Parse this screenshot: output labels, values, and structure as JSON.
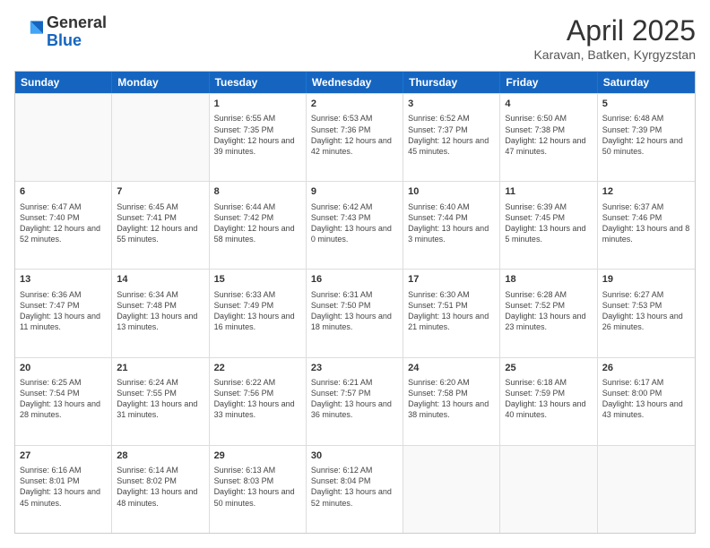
{
  "header": {
    "logo_general": "General",
    "logo_blue": "Blue",
    "title": "April 2025",
    "location": "Karavan, Batken, Kyrgyzstan"
  },
  "weekdays": [
    "Sunday",
    "Monday",
    "Tuesday",
    "Wednesday",
    "Thursday",
    "Friday",
    "Saturday"
  ],
  "rows": [
    [
      {
        "day": "",
        "info": ""
      },
      {
        "day": "",
        "info": ""
      },
      {
        "day": "1",
        "info": "Sunrise: 6:55 AM\nSunset: 7:35 PM\nDaylight: 12 hours and 39 minutes."
      },
      {
        "day": "2",
        "info": "Sunrise: 6:53 AM\nSunset: 7:36 PM\nDaylight: 12 hours and 42 minutes."
      },
      {
        "day": "3",
        "info": "Sunrise: 6:52 AM\nSunset: 7:37 PM\nDaylight: 12 hours and 45 minutes."
      },
      {
        "day": "4",
        "info": "Sunrise: 6:50 AM\nSunset: 7:38 PM\nDaylight: 12 hours and 47 minutes."
      },
      {
        "day": "5",
        "info": "Sunrise: 6:48 AM\nSunset: 7:39 PM\nDaylight: 12 hours and 50 minutes."
      }
    ],
    [
      {
        "day": "6",
        "info": "Sunrise: 6:47 AM\nSunset: 7:40 PM\nDaylight: 12 hours and 52 minutes."
      },
      {
        "day": "7",
        "info": "Sunrise: 6:45 AM\nSunset: 7:41 PM\nDaylight: 12 hours and 55 minutes."
      },
      {
        "day": "8",
        "info": "Sunrise: 6:44 AM\nSunset: 7:42 PM\nDaylight: 12 hours and 58 minutes."
      },
      {
        "day": "9",
        "info": "Sunrise: 6:42 AM\nSunset: 7:43 PM\nDaylight: 13 hours and 0 minutes."
      },
      {
        "day": "10",
        "info": "Sunrise: 6:40 AM\nSunset: 7:44 PM\nDaylight: 13 hours and 3 minutes."
      },
      {
        "day": "11",
        "info": "Sunrise: 6:39 AM\nSunset: 7:45 PM\nDaylight: 13 hours and 5 minutes."
      },
      {
        "day": "12",
        "info": "Sunrise: 6:37 AM\nSunset: 7:46 PM\nDaylight: 13 hours and 8 minutes."
      }
    ],
    [
      {
        "day": "13",
        "info": "Sunrise: 6:36 AM\nSunset: 7:47 PM\nDaylight: 13 hours and 11 minutes."
      },
      {
        "day": "14",
        "info": "Sunrise: 6:34 AM\nSunset: 7:48 PM\nDaylight: 13 hours and 13 minutes."
      },
      {
        "day": "15",
        "info": "Sunrise: 6:33 AM\nSunset: 7:49 PM\nDaylight: 13 hours and 16 minutes."
      },
      {
        "day": "16",
        "info": "Sunrise: 6:31 AM\nSunset: 7:50 PM\nDaylight: 13 hours and 18 minutes."
      },
      {
        "day": "17",
        "info": "Sunrise: 6:30 AM\nSunset: 7:51 PM\nDaylight: 13 hours and 21 minutes."
      },
      {
        "day": "18",
        "info": "Sunrise: 6:28 AM\nSunset: 7:52 PM\nDaylight: 13 hours and 23 minutes."
      },
      {
        "day": "19",
        "info": "Sunrise: 6:27 AM\nSunset: 7:53 PM\nDaylight: 13 hours and 26 minutes."
      }
    ],
    [
      {
        "day": "20",
        "info": "Sunrise: 6:25 AM\nSunset: 7:54 PM\nDaylight: 13 hours and 28 minutes."
      },
      {
        "day": "21",
        "info": "Sunrise: 6:24 AM\nSunset: 7:55 PM\nDaylight: 13 hours and 31 minutes."
      },
      {
        "day": "22",
        "info": "Sunrise: 6:22 AM\nSunset: 7:56 PM\nDaylight: 13 hours and 33 minutes."
      },
      {
        "day": "23",
        "info": "Sunrise: 6:21 AM\nSunset: 7:57 PM\nDaylight: 13 hours and 36 minutes."
      },
      {
        "day": "24",
        "info": "Sunrise: 6:20 AM\nSunset: 7:58 PM\nDaylight: 13 hours and 38 minutes."
      },
      {
        "day": "25",
        "info": "Sunrise: 6:18 AM\nSunset: 7:59 PM\nDaylight: 13 hours and 40 minutes."
      },
      {
        "day": "26",
        "info": "Sunrise: 6:17 AM\nSunset: 8:00 PM\nDaylight: 13 hours and 43 minutes."
      }
    ],
    [
      {
        "day": "27",
        "info": "Sunrise: 6:16 AM\nSunset: 8:01 PM\nDaylight: 13 hours and 45 minutes."
      },
      {
        "day": "28",
        "info": "Sunrise: 6:14 AM\nSunset: 8:02 PM\nDaylight: 13 hours and 48 minutes."
      },
      {
        "day": "29",
        "info": "Sunrise: 6:13 AM\nSunset: 8:03 PM\nDaylight: 13 hours and 50 minutes."
      },
      {
        "day": "30",
        "info": "Sunrise: 6:12 AM\nSunset: 8:04 PM\nDaylight: 13 hours and 52 minutes."
      },
      {
        "day": "",
        "info": ""
      },
      {
        "day": "",
        "info": ""
      },
      {
        "day": "",
        "info": ""
      }
    ]
  ]
}
